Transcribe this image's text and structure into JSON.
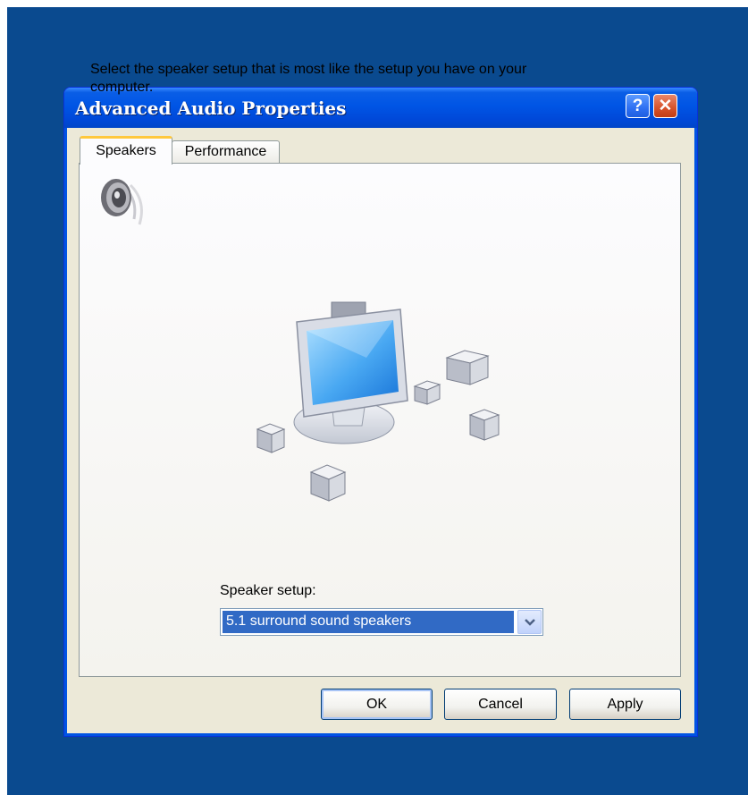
{
  "window": {
    "title": "Advanced Audio Properties",
    "help_glyph": "?",
    "close_glyph": "✕"
  },
  "tabs": [
    {
      "label": "Speakers",
      "selected": true
    },
    {
      "label": "Performance",
      "selected": false
    }
  ],
  "speakers_tab": {
    "description": "Select the speaker setup that is most like the setup you have on your computer.",
    "setup_label": "Speaker setup:",
    "setup_value": "5.1 surround sound speakers"
  },
  "buttons": {
    "ok": "OK",
    "cancel": "Cancel",
    "apply": "Apply"
  },
  "colors": {
    "desktop": "#0a4a8f",
    "titlebar": "#0055e5",
    "selection": "#316ac5"
  }
}
